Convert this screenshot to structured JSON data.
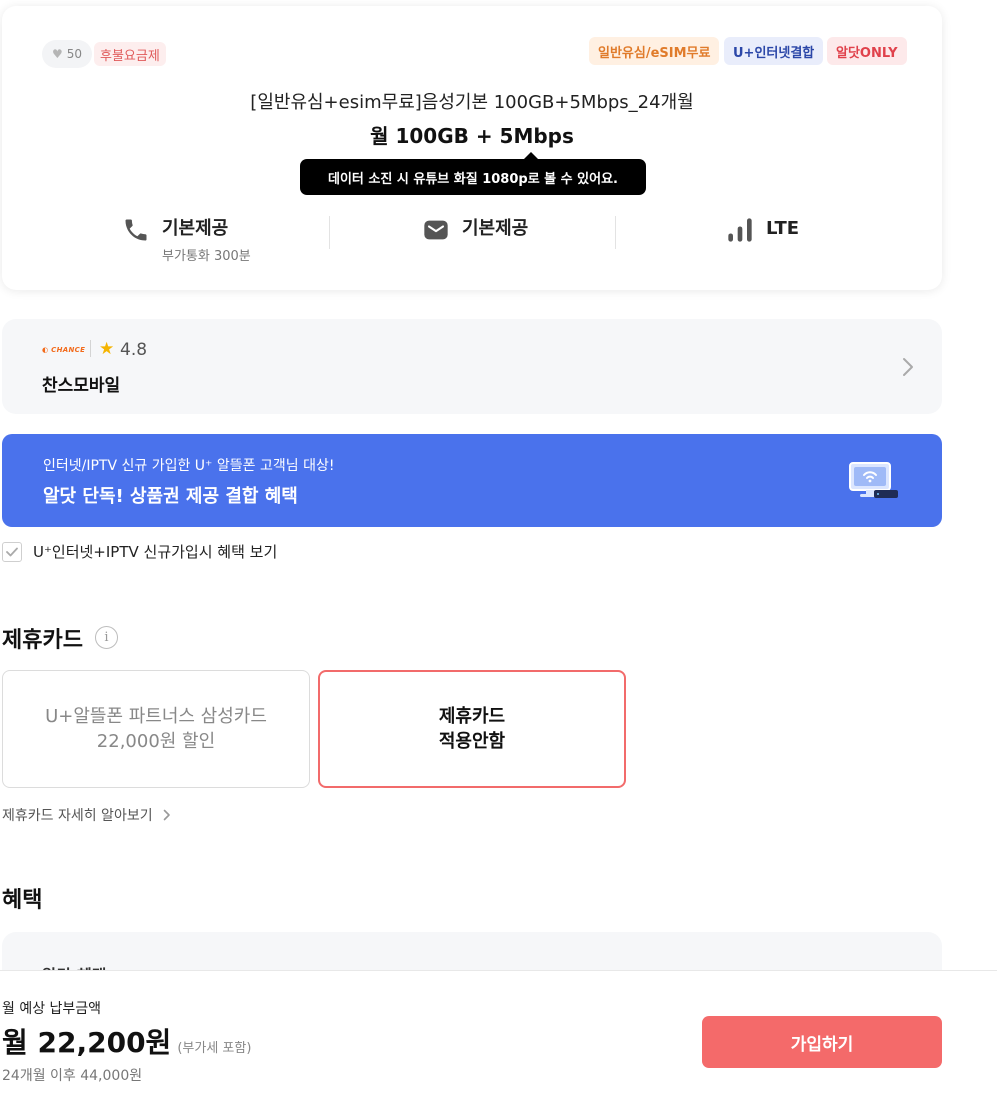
{
  "plan": {
    "likes": "50",
    "postpay_badge": "후불요금제",
    "tags": [
      "일반유심/eSIM무료",
      "U+인터넷결합",
      "알닷ONLY"
    ],
    "name": "[일반유심+esim무료]음성기본 100GB+5Mbps_24개월",
    "data_summary": "월 100GB + 5Mbps",
    "tooltip": "데이터 소진 시 유튜브 화질 1080p로 볼 수 있어요.",
    "features": {
      "call": {
        "main": "기본제공",
        "sub": "부가통화 300분",
        "icon": "phone-icon"
      },
      "sms": {
        "main": "기본제공",
        "icon": "message-icon"
      },
      "network": {
        "main": "LTE",
        "icon": "signal-icon"
      }
    }
  },
  "carrier": {
    "logo_text": "CHANCE",
    "rating": "4.8",
    "name": "찬스모바일"
  },
  "banner": {
    "subtitle": "인터넷/IPTV 신규 가입한 U⁺ 알뜰폰 고객님 대상!",
    "title": "알닷 단독! 상품권 제공 결합 혜택",
    "icon": "tv-settop-icon"
  },
  "benefit_check": {
    "label": "U⁺인터넷+IPTV 신규가입시 혜택 보기",
    "checked": true
  },
  "partner_card": {
    "section_title": "제휴카드",
    "options": [
      {
        "line1": "U+알뜰폰 파트너스 삼성카드",
        "line2": "22,000원 할인",
        "selected": false
      },
      {
        "line1": "제휴카드",
        "line2": "적용안함",
        "selected": true
      }
    ],
    "more_link": "제휴카드 자세히 알아보기"
  },
  "benefits": {
    "section_title": "혜택",
    "card_title": "알닷 혜택"
  },
  "bottom": {
    "pay_label": "월 예상 납부금액",
    "amount": "월 22,200원",
    "vat_note": "(부가세 포함)",
    "after_note": "24개월 이후 44,000원",
    "join_button": "가입하기"
  },
  "colors": {
    "brand_red": "#f46a6a",
    "banner_blue": "#4a72ec",
    "tag_orange": "#e07b2a",
    "tag_blue": "#2b47a8",
    "tag_red": "#e0414b",
    "star": "#f5b400"
  }
}
